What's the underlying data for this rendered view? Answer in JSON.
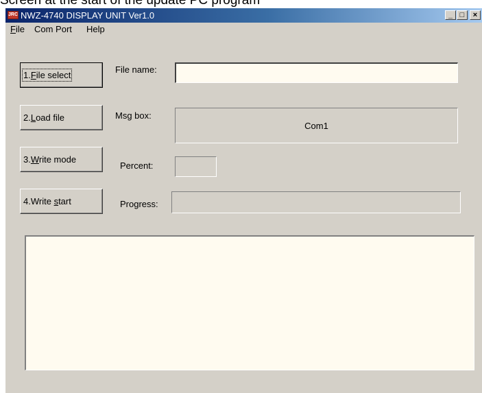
{
  "caption": "Screen at the start of the update PC program",
  "window": {
    "title": "NWZ-4740 DISPLAY UNIT Ver1.0",
    "icon_text": "JRC",
    "minimize_symbol": "_",
    "maximize_symbol": "□",
    "close_symbol": "×"
  },
  "menu": {
    "file_mnemonic": "F",
    "file_rest": "ile",
    "com_port": "Com Port",
    "help": "Help"
  },
  "buttons": {
    "file_select": {
      "prefix": "1.",
      "mnemonic": "F",
      "rest": "ile select"
    },
    "load_file": {
      "prefix": "2.",
      "mnemonic": "L",
      "rest": "oad file"
    },
    "write_mode": {
      "prefix": "3.",
      "mnemonic": "W",
      "rest": "rite mode"
    },
    "write_start": {
      "prefix": "4.Write ",
      "mnemonic": "s",
      "rest": "tart"
    }
  },
  "labels": {
    "file_name": "File name:",
    "msg_box": "Msg box:",
    "percent": "Percent:",
    "progress": "Progress:"
  },
  "fields": {
    "file_name_value": "",
    "msg_box_value": "Com1",
    "percent_value": "",
    "progress_value": 0,
    "log_value": ""
  }
}
